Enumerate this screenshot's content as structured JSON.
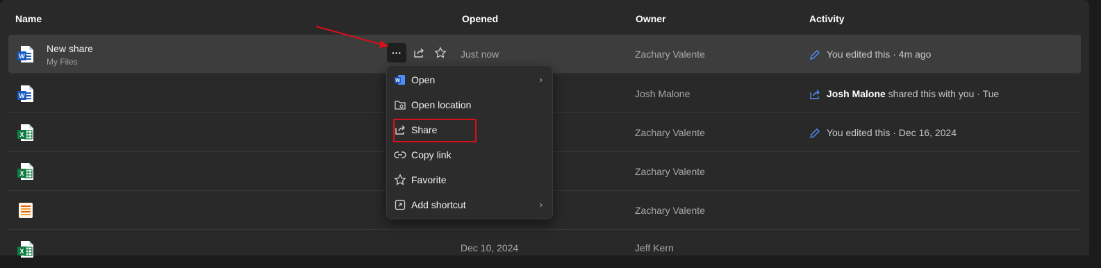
{
  "columns": {
    "name": "Name",
    "opened": "Opened",
    "owner": "Owner",
    "activity": "Activity"
  },
  "rows": [
    {
      "icon": "word-file-icon",
      "name": "New share",
      "location": "My Files",
      "opened": "Just now",
      "owner": "Zachary Valente",
      "activity_icon": "pencil-icon",
      "activity_text": "You edited this · 4m ago"
    },
    {
      "icon": "word-file-icon",
      "name": "",
      "opened": "",
      "owner": "Josh Malone",
      "activity_icon": "share-icon",
      "activity_user": "Josh Malone",
      "activity_text": " shared this with you · Tue"
    },
    {
      "icon": "excel-file-icon",
      "name": "",
      "opened": "",
      "owner": "Zachary Valente",
      "activity_icon": "pencil-icon",
      "activity_text": "You edited this · Dec 16, 2024"
    },
    {
      "icon": "excel-file-icon",
      "name": "",
      "opened": "",
      "owner": "Zachary Valente"
    },
    {
      "icon": "list-file-icon",
      "name": "",
      "opened": "",
      "owner": "Zachary Valente"
    },
    {
      "icon": "excel-file-icon",
      "name": "",
      "opened": "Dec 10, 2024",
      "owner": "Jeff Kern"
    }
  ],
  "context_menu": {
    "items": [
      {
        "label": "Open",
        "icon": "word-icon",
        "submenu": true
      },
      {
        "label": "Open location",
        "icon": "folder-location-icon",
        "submenu": false
      },
      {
        "label": "Share",
        "icon": "share-icon",
        "submenu": false
      },
      {
        "label": "Copy link",
        "icon": "link-icon",
        "submenu": false
      },
      {
        "label": "Favorite",
        "icon": "star-icon",
        "submenu": false
      },
      {
        "label": "Add shortcut",
        "icon": "shortcut-icon",
        "submenu": true
      }
    ]
  },
  "more_button": {
    "label": "···"
  },
  "colors": {
    "accent": "#4f8ff7",
    "annotation_red": "#d8101a",
    "word_blue": "#185abd",
    "excel_green": "#107c41"
  }
}
